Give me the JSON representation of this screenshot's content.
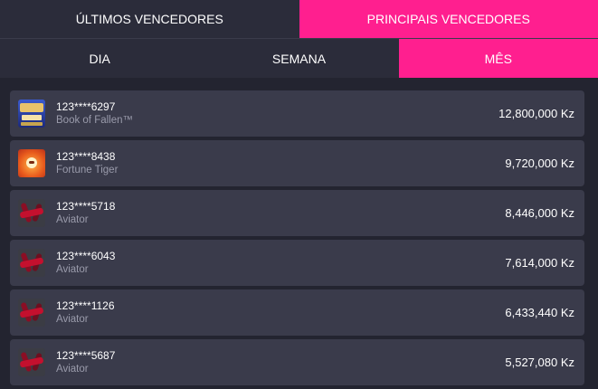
{
  "tabs_top": [
    {
      "label": "ÚLTIMOS VENCEDORES",
      "active": false
    },
    {
      "label": "PRINCIPAIS VENCEDORES",
      "active": true
    }
  ],
  "tabs_period": [
    {
      "label": "DIA",
      "active": false
    },
    {
      "label": "SEMANA",
      "active": false
    },
    {
      "label": "MÊS",
      "active": true
    }
  ],
  "winners": [
    {
      "user": "123****6297",
      "game": "Book of Fallen™",
      "amount": "12,800,000 Kz",
      "icon": "book-of-fallen-icon"
    },
    {
      "user": "123****8438",
      "game": "Fortune Tiger",
      "amount": "9,720,000 Kz",
      "icon": "fortune-tiger-icon"
    },
    {
      "user": "123****5718",
      "game": "Aviator",
      "amount": "8,446,000 Kz",
      "icon": "aviator-icon"
    },
    {
      "user": "123****6043",
      "game": "Aviator",
      "amount": "7,614,000 Kz",
      "icon": "aviator-icon"
    },
    {
      "user": "123****1126",
      "game": "Aviator",
      "amount": "6,433,440 Kz",
      "icon": "aviator-icon"
    },
    {
      "user": "123****5687",
      "game": "Aviator",
      "amount": "5,527,080 Kz",
      "icon": "aviator-icon"
    }
  ],
  "colors": {
    "accent": "#ff1f8f",
    "background": "#232430",
    "row": "#3a3b4b",
    "tab": "#2b2c3a"
  }
}
